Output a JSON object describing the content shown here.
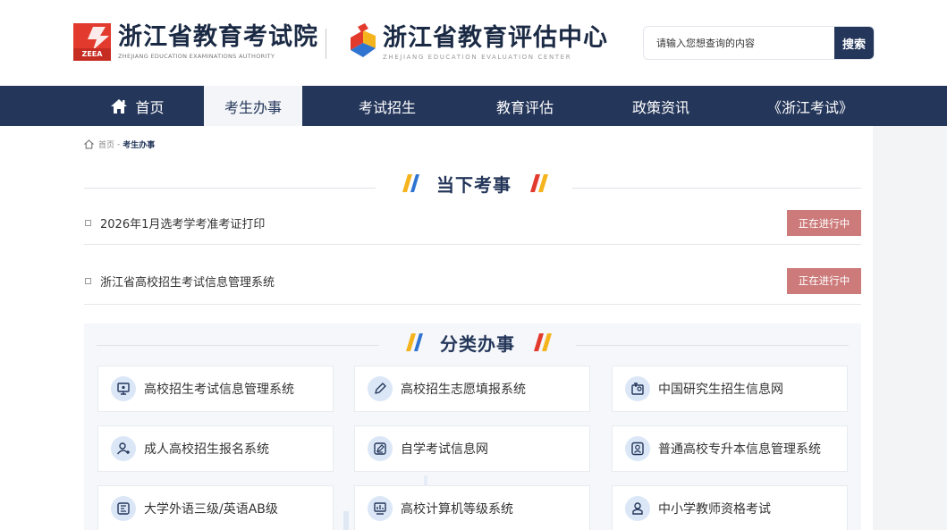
{
  "header": {
    "logo_left": {
      "title": "浙江省教育考试院",
      "subtitle": "ZHEJIANG EDUCATION EXAMINATIONS AUTHORITY",
      "mark_text": "ZEEA"
    },
    "logo_right": {
      "title": "浙江省教育评估中心",
      "subtitle": "ZHEJIANG EDUCATION EVALUATION CENTER"
    },
    "search": {
      "placeholder": "请输入您想查询的内容",
      "button_label": "搜索"
    }
  },
  "nav": {
    "items": [
      {
        "label": "首页",
        "icon": "home-icon"
      },
      {
        "label": "考生办事",
        "active": true
      },
      {
        "label": "考试招生"
      },
      {
        "label": "教育评估"
      },
      {
        "label": "政策资讯"
      },
      {
        "label": "《浙江考试》"
      }
    ]
  },
  "breadcrumb": {
    "home": "首页",
    "separator": "-",
    "current": "考生办事"
  },
  "current_exams": {
    "title": "当下考事",
    "items": [
      {
        "title": "2026年1月选考学考准考证打印",
        "status": "正在进行中"
      },
      {
        "title": "浙江省高校招生考试信息管理系统",
        "status": "正在进行中"
      }
    ]
  },
  "categories": {
    "title": "分类办事",
    "items": [
      {
        "label": "高校招生考试信息管理系统",
        "icon": "monitor-icon"
      },
      {
        "label": "高校招生志愿填报系统",
        "icon": "pencil-icon"
      },
      {
        "label": "中国研究生招生信息网",
        "icon": "graduate-icon"
      },
      {
        "label": "成人高校招生报名系统",
        "icon": "user-add-icon"
      },
      {
        "label": "自学考试信息网",
        "icon": "edit-icon"
      },
      {
        "label": "普通高校专升本信息管理系统",
        "icon": "id-card-icon"
      },
      {
        "label": "大学外语三级/英语AB级",
        "icon": "english-icon"
      },
      {
        "label": "高校计算机等级系统",
        "icon": "computer-icon"
      },
      {
        "label": "中小学教师资格考试",
        "icon": "teacher-icon"
      }
    ]
  },
  "colors": {
    "primary": "#24365a",
    "badge": "#cc7a7a",
    "accent_yellow": "#f5b41e",
    "accent_blue": "#2f74d0",
    "accent_red": "#e23b2e",
    "icon_bg": "#dbe7f7"
  }
}
